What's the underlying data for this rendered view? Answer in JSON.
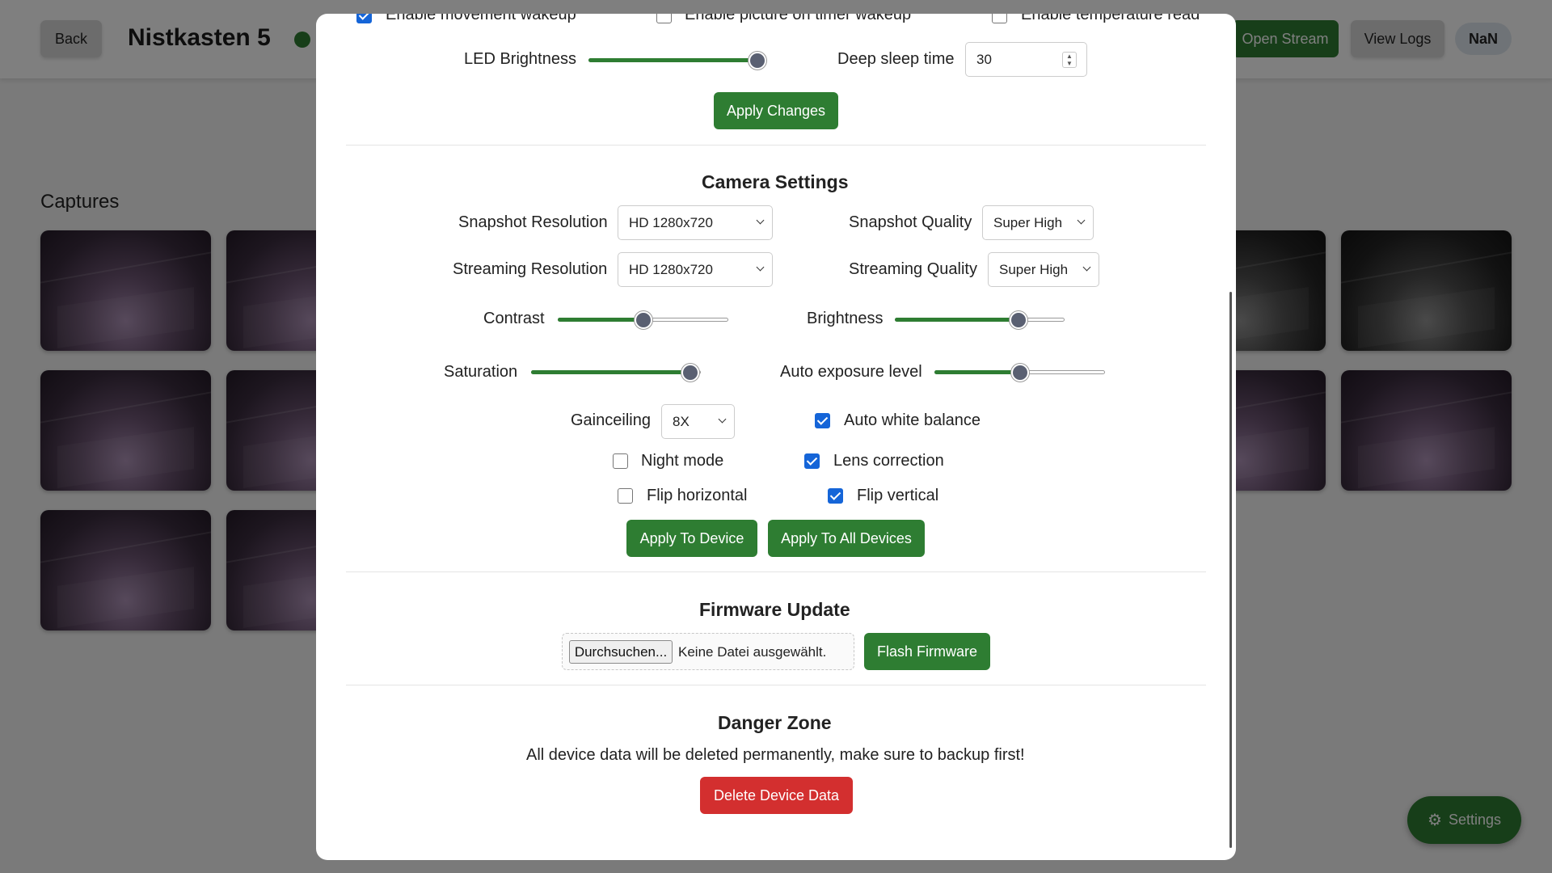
{
  "header": {
    "back_label": "Back",
    "device_name": "Nistkasten 5",
    "open_stream_label": "Open Stream",
    "view_logs_label": "View Logs",
    "status_value": "NaN"
  },
  "captures": {
    "title": "Captures"
  },
  "settings_button": {
    "label": "Settings",
    "icon": "gear-icon"
  },
  "modal": {
    "wakeup": {
      "movement_label": "Enable movement wakeup",
      "movement_checked": true,
      "timer_label": "Enable picture on timer wakeup",
      "timer_checked": false,
      "temperature_label": "Enable temperature read",
      "temperature_checked": false
    },
    "led_brightness": {
      "label": "LED Brightness",
      "value": 1.0
    },
    "deep_sleep": {
      "label": "Deep sleep time",
      "value": "30"
    },
    "apply_changes_label": "Apply Changes",
    "camera": {
      "title": "Camera Settings",
      "snapshot_resolution": {
        "label": "Snapshot Resolution",
        "value": "HD 1280x720"
      },
      "snapshot_quality": {
        "label": "Snapshot Quality",
        "value": "Super High"
      },
      "streaming_resolution": {
        "label": "Streaming Resolution",
        "value": "HD 1280x720"
      },
      "streaming_quality": {
        "label": "Streaming Quality",
        "value": "Super High"
      },
      "contrast": {
        "label": "Contrast",
        "value": 0.5
      },
      "brightness": {
        "label": "Brightness",
        "value": 0.73
      },
      "saturation": {
        "label": "Saturation",
        "value": 0.94
      },
      "auto_exposure": {
        "label": "Auto exposure level",
        "value": 0.5
      },
      "gainceiling": {
        "label": "Gainceiling",
        "value": "8X"
      },
      "auto_white_balance": {
        "label": "Auto white balance",
        "checked": true
      },
      "night_mode": {
        "label": "Night mode",
        "checked": false
      },
      "lens_correction": {
        "label": "Lens correction",
        "checked": true
      },
      "flip_horizontal": {
        "label": "Flip horizontal",
        "checked": false
      },
      "flip_vertical": {
        "label": "Flip vertical",
        "checked": true
      },
      "apply_device_label": "Apply To Device",
      "apply_all_label": "Apply To All Devices"
    },
    "firmware": {
      "title": "Firmware Update",
      "browse_label": "Durchsuchen...",
      "file_status": "Keine Datei ausgewählt.",
      "flash_label": "Flash Firmware"
    },
    "danger": {
      "title": "Danger Zone",
      "warning": "All device data will be deleted permanently, make sure to backup first!",
      "delete_label": "Delete Device Data"
    }
  },
  "colors": {
    "accent": "#2e7d32",
    "danger": "#d32f2f",
    "checkbox": "#1565d8"
  }
}
